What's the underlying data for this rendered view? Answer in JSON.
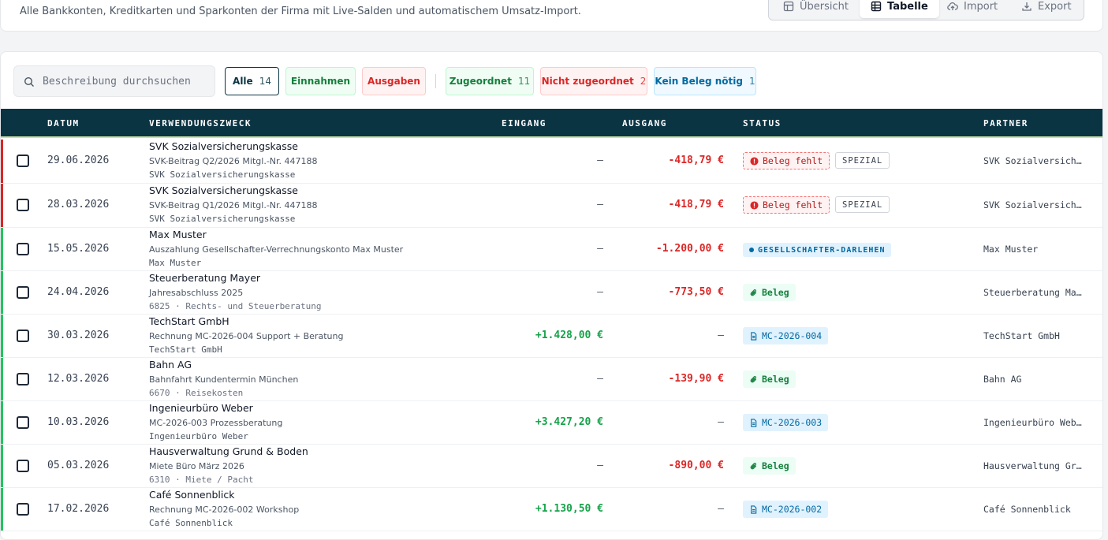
{
  "header": {
    "subtitle": "Alle Bankkonten, Kreditkarten und Sparkonten der Firma mit Live-Salden und automatischem Umsatz-Import.",
    "view_tabs": [
      "Übersicht",
      "Tabelle",
      "Import",
      "Export"
    ],
    "active_tab": "Tabelle"
  },
  "filters": {
    "search_placeholder": "Beschreibung durchsuchen",
    "chips": [
      {
        "label": "Alle",
        "count": "14"
      },
      {
        "label": "Einnahmen",
        "count": ""
      },
      {
        "label": "Ausgaben",
        "count": ""
      },
      {
        "label": "Zugeordnet",
        "count": "11"
      },
      {
        "label": "Nicht zugeordnet",
        "count": "2"
      },
      {
        "label": "Kein Beleg nötig",
        "count": "1"
      }
    ]
  },
  "table": {
    "columns": [
      "DATUM",
      "VERWENDUNGSZWECK",
      "EINGANG",
      "AUSGANG",
      "STATUS",
      "PARTNER"
    ],
    "rows": [
      {
        "date": "29.06.2026",
        "title": "SVK Sozialversicherungskasse",
        "sub": "SVK-Beitrag Q2/2026 Mitgl.-Nr. 447188",
        "meta": "SVK Sozialversicherungskasse",
        "in": "—",
        "out": "-418,79 €",
        "status": "Beleg fehlt",
        "tag": "SPEZIAL",
        "partner": "SVK Sozialversicherungskasse"
      },
      {
        "date": "28.03.2026",
        "title": "SVK Sozialversicherungskasse",
        "sub": "SVK-Beitrag Q1/2026 Mitgl.-Nr. 447188",
        "meta": "SVK Sozialversicherungskasse",
        "in": "—",
        "out": "-418,79 €",
        "status": "Beleg fehlt",
        "tag": "SPEZIAL",
        "partner": "SVK Sozialversicherungskasse"
      },
      {
        "date": "15.05.2026",
        "title": "Max Muster",
        "sub": "Auszahlung Gesellschafter-Verrechnungskonto Max Muster",
        "meta": "Max Muster",
        "in": "—",
        "out": "-1.200,00 €",
        "status": "GESELLSCHAFTER-DARLEHEN",
        "tag": "",
        "partner": "Max Muster"
      },
      {
        "date": "24.04.2026",
        "title": "Steuerberatung Mayer",
        "sub": "Jahresabschluss 2025",
        "meta": "6825 · Rechts- und Steuerberatung",
        "in": "—",
        "out": "-773,50 €",
        "status": "Beleg",
        "tag": "",
        "partner": "Steuerberatung Mayer"
      },
      {
        "date": "30.03.2026",
        "title": "TechStart GmbH",
        "sub": "Rechnung MC-2026-004 Support + Beratung",
        "meta": "TechStart GmbH",
        "in": "+1.428,00 €",
        "out": "—",
        "status": "MC-2026-004",
        "tag": "",
        "partner": "TechStart GmbH"
      },
      {
        "date": "12.03.2026",
        "title": "Bahn AG",
        "sub": "Bahnfahrt Kundentermin München",
        "meta": "6670 · Reisekosten",
        "in": "—",
        "out": "-139,90 €",
        "status": "Beleg",
        "tag": "",
        "partner": "Bahn AG"
      },
      {
        "date": "10.03.2026",
        "title": "Ingenieurbüro Weber",
        "sub": "MC-2026-003 Prozessberatung",
        "meta": "Ingenieurbüro Weber",
        "in": "+3.427,20 €",
        "out": "—",
        "status": "MC-2026-003",
        "tag": "",
        "partner": "Ingenieurbüro Weber"
      },
      {
        "date": "05.03.2026",
        "title": "Hausverwaltung Grund & Boden",
        "sub": "Miete Büro März 2026",
        "meta": "6310 · Miete / Pacht",
        "in": "—",
        "out": "-890,00 €",
        "status": "Beleg",
        "tag": "",
        "partner": "Hausverwaltung Grund & Boden"
      },
      {
        "date": "17.02.2026",
        "title": "Café Sonnenblick",
        "sub": "Rechnung MC-2026-002 Workshop",
        "meta": "Café Sonnenblick",
        "in": "+1.130,50 €",
        "out": "—",
        "status": "MC-2026-002",
        "tag": "",
        "partner": "Café Sonnenblick"
      }
    ]
  },
  "colors": {
    "header_bg": "#0b3443",
    "positive": "#16a34a",
    "negative": "#dc2626",
    "row_bar_red": "#dc2626",
    "row_bar_green": "#22c55e"
  }
}
